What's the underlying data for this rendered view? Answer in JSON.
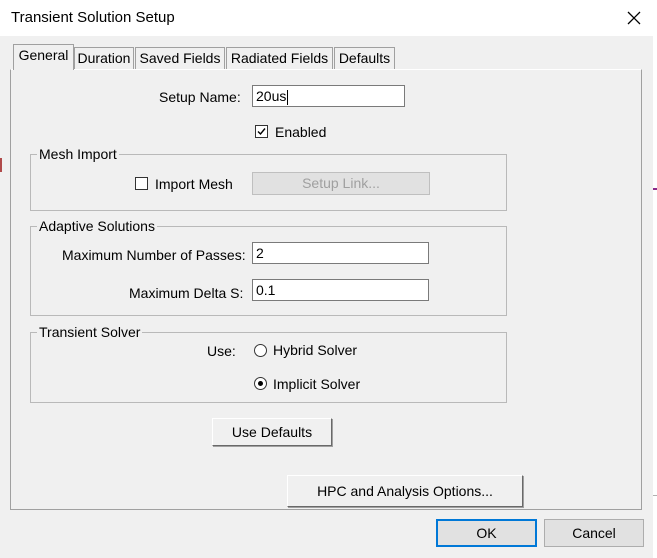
{
  "window": {
    "title": "Transient Solution Setup"
  },
  "tabs": [
    {
      "label": "General",
      "active": true
    },
    {
      "label": "Duration",
      "active": false
    },
    {
      "label": "Saved Fields",
      "active": false
    },
    {
      "label": "Radiated Fields",
      "active": false
    },
    {
      "label": "Defaults",
      "active": false
    }
  ],
  "general": {
    "setup_name_label": "Setup Name:",
    "setup_name_value": "20us",
    "enabled_label": "Enabled",
    "enabled_checked": true
  },
  "mesh_import": {
    "title": "Mesh Import",
    "import_mesh_label": "Import Mesh",
    "import_mesh_checked": false,
    "setup_link_label": "Setup Link..."
  },
  "adaptive": {
    "title": "Adaptive Solutions",
    "max_passes_label": "Maximum Number of Passes:",
    "max_passes_value": "2",
    "max_delta_label": "Maximum Delta S:",
    "max_delta_value": "0.1"
  },
  "solver": {
    "title": "Transient Solver",
    "use_label": "Use:",
    "hybrid_label": "Hybrid Solver",
    "implicit_label": "Implicit Solver",
    "selected": "Implicit Solver"
  },
  "buttons": {
    "use_defaults": "Use Defaults",
    "hpc": "HPC and Analysis Options...",
    "ok": "OK",
    "cancel": "Cancel"
  }
}
